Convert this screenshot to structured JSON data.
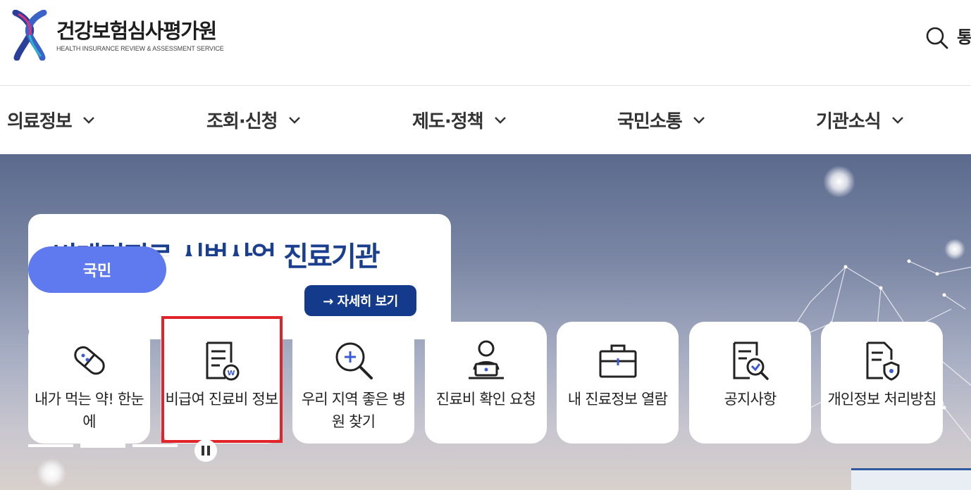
{
  "header": {
    "logo_title": "건강보험심사평가원",
    "logo_subtitle": "HEALTH INSURANCE REVIEW & ASSESSMENT SERVICE",
    "search_icon": "search-icon",
    "search_label": "통"
  },
  "nav": {
    "items": [
      {
        "label": "의료정보",
        "icon": "chevron-down-icon"
      },
      {
        "label": "조회·신청",
        "icon": "chevron-down-icon"
      },
      {
        "label": "제도·정책",
        "icon": "chevron-down-icon"
      },
      {
        "label": "국민소통",
        "icon": "chevron-down-icon"
      },
      {
        "label": "기관소식",
        "icon": "chevron-down-icon"
      }
    ]
  },
  "hero": {
    "banner_title": "비대면진료 시범사업 진료기관",
    "detail_button": "→ 자세히 보기",
    "active_tab": "국민",
    "cards": [
      {
        "label": "내가 먹는 약! 한눈에",
        "icon": "pill-icon"
      },
      {
        "label": "비급여 진료비 정보",
        "icon": "billing-document-icon"
      },
      {
        "label": "우리 지역 좋은 병원 찾기",
        "icon": "search-plus-icon"
      },
      {
        "label": "진료비 확인 요청",
        "icon": "person-laptop-icon"
      },
      {
        "label": "내 진료정보 열람",
        "icon": "medical-bag-icon"
      },
      {
        "label": "공지사항",
        "icon": "document-search-icon"
      },
      {
        "label": "개인정보 처리방침",
        "icon": "shield-document-icon"
      }
    ],
    "slide_indicators": 3,
    "active_slide": 2,
    "pause_icon": "pause-icon"
  },
  "colors": {
    "brand_blue": "#1b3f8f",
    "button_blue": "#133a8b",
    "tab_blue": "#5f79ee",
    "highlight_red": "#e0242a"
  }
}
